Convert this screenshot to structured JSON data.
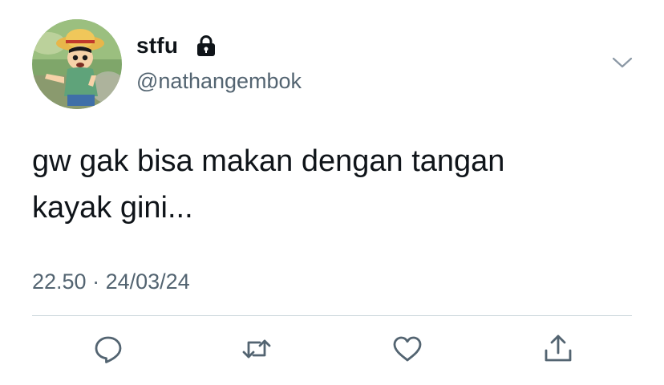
{
  "tweet": {
    "display_name": "stfu",
    "handle": "@nathangembok",
    "protected_icon": "lock-icon",
    "more_icon": "chevron-down-icon",
    "text_lines": [
      "gw gak bisa makan dengan tangan",
      "kayak gini..."
    ],
    "time": "22.50",
    "separator": "·",
    "date": "24/03/24"
  },
  "actions": [
    {
      "name": "reply",
      "icon": "reply-icon"
    },
    {
      "name": "retweet",
      "icon": "retweet-icon"
    },
    {
      "name": "like",
      "icon": "heart-icon"
    },
    {
      "name": "share",
      "icon": "share-icon"
    }
  ],
  "colors": {
    "text_primary": "#0f1419",
    "text_secondary": "#536471",
    "divider": "#cfd9de"
  }
}
